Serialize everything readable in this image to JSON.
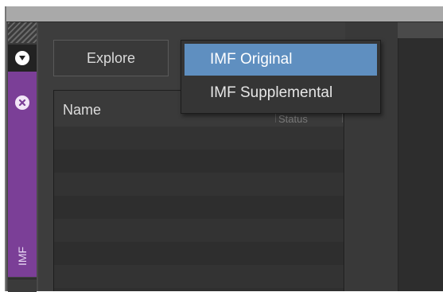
{
  "sidebar": {
    "dock_icon": "chevron-down-circle-icon",
    "close_icon": "close-circle-icon",
    "tab_label": "IMF",
    "tab_color": "#7b3f97"
  },
  "toolbar": {
    "explore_label": "Explore"
  },
  "table": {
    "columns": [
      "Name",
      "Status"
    ]
  },
  "menu": {
    "items": [
      {
        "label": "IMF Original",
        "selected": true
      },
      {
        "label": "IMF Supplemental",
        "selected": false
      }
    ],
    "highlight_color": "#5f8fc0"
  }
}
